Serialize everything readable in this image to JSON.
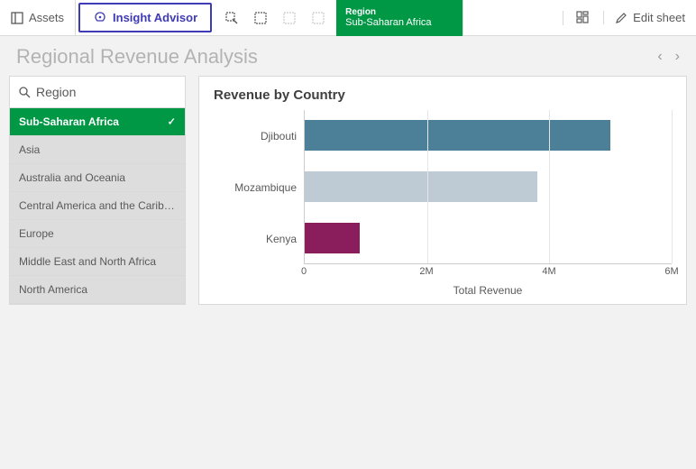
{
  "toolbar": {
    "assets_label": "Assets",
    "insight_label": "Insight Advisor",
    "selection_pill": {
      "label": "Region",
      "value": "Sub-Saharan Africa"
    },
    "edit_label": "Edit sheet"
  },
  "page": {
    "title": "Regional Revenue Analysis"
  },
  "filter": {
    "field": "Region",
    "items": [
      {
        "label": "Sub-Saharan Africa",
        "selected": true
      },
      {
        "label": "Asia",
        "selected": false
      },
      {
        "label": "Australia and Oceania",
        "selected": false
      },
      {
        "label": "Central America and the Carib…",
        "selected": false
      },
      {
        "label": "Europe",
        "selected": false
      },
      {
        "label": "Middle East and North Africa",
        "selected": false
      },
      {
        "label": "North America",
        "selected": false
      }
    ]
  },
  "chart": {
    "title": "Revenue by Country",
    "xlabel": "Total Revenue"
  },
  "chart_data": {
    "type": "bar",
    "orientation": "horizontal",
    "title": "Revenue by Country",
    "xlabel": "Total Revenue",
    "ylabel": "",
    "categories": [
      "Djibouti",
      "Mozambique",
      "Kenya"
    ],
    "values": [
      5000000,
      3800000,
      900000
    ],
    "colors": [
      "#4c7f98",
      "#bfcbd4",
      "#8a1e5c"
    ],
    "xlim": [
      0,
      6000000
    ],
    "xticks": [
      0,
      2000000,
      4000000,
      6000000
    ],
    "xtick_labels": [
      "0",
      "2M",
      "4M",
      "6M"
    ]
  }
}
